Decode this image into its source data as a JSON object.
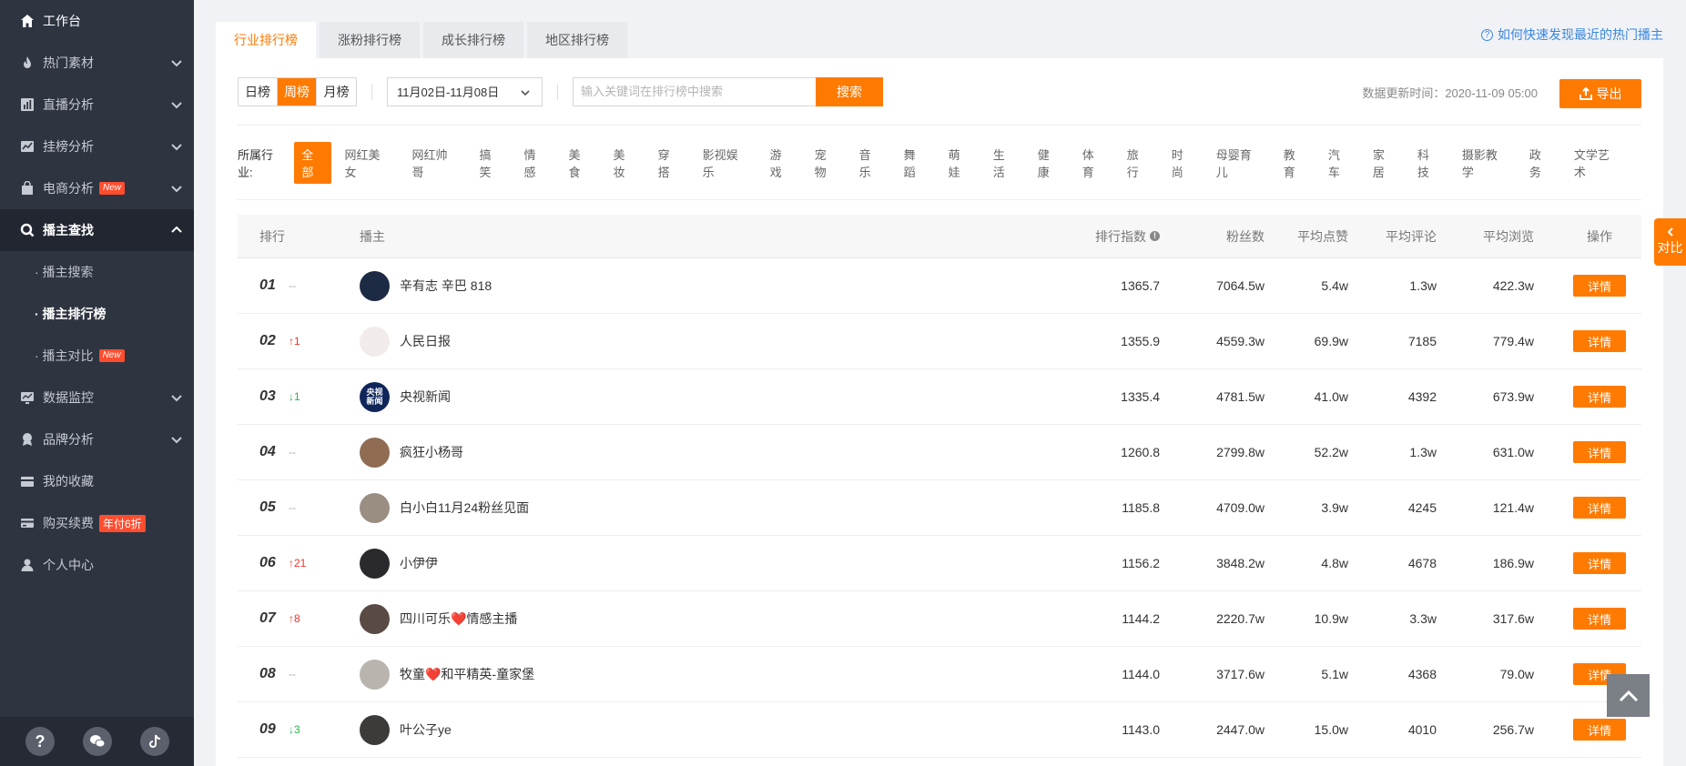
{
  "sidebar": {
    "items": [
      {
        "label": "工作台",
        "icon": "home-icon",
        "has_arrow": false
      },
      {
        "label": "热门素材",
        "icon": "fire-icon",
        "has_arrow": true
      },
      {
        "label": "直播分析",
        "icon": "bar-chart-icon",
        "has_arrow": true
      },
      {
        "label": "挂榜分析",
        "icon": "trend-icon",
        "has_arrow": true
      },
      {
        "label": "电商分析",
        "icon": "shopping-bag-icon",
        "has_arrow": true,
        "badge": "New"
      },
      {
        "label": "播主查找",
        "icon": "search-icon",
        "has_arrow": true,
        "expanded": true
      }
    ],
    "sub_items": [
      {
        "label": "· 播主搜索"
      },
      {
        "label": "· 播主排行榜"
      },
      {
        "label": "· 播主对比",
        "badge": "New"
      }
    ],
    "items_after": [
      {
        "label": "数据监控",
        "icon": "monitor-icon",
        "has_arrow": true
      },
      {
        "label": "品牌分析",
        "icon": "brand-icon",
        "has_arrow": true
      },
      {
        "label": "我的收藏",
        "icon": "wallet-icon"
      },
      {
        "label": "购买续费",
        "icon": "card-icon",
        "badge": "年付6折"
      },
      {
        "label": "个人中心",
        "icon": "user-icon"
      }
    ]
  },
  "tabs": [
    "行业排行榜",
    "涨粉排行榜",
    "成长排行榜",
    "地区排行榜"
  ],
  "help_link": "如何快速发现最近的热门播主",
  "toolbar": {
    "period_buttons": [
      "日榜",
      "周榜",
      "月榜"
    ],
    "date_range": "11月02日-11月08日",
    "search_placeholder": "输入关键词在排行榜中搜索",
    "search_button": "搜索",
    "update_time": "数据更新时间：2020-11-09 05:00",
    "export_button": "导出"
  },
  "industry": {
    "label": "所属行业:",
    "tags": [
      "全部",
      "网红美女",
      "网红帅哥",
      "搞笑",
      "情感",
      "美食",
      "美妆",
      "穿搭",
      "影视娱乐",
      "游戏",
      "宠物",
      "音乐",
      "舞蹈",
      "萌娃",
      "生活",
      "健康",
      "体育",
      "旅行",
      "时尚",
      "母婴育儿",
      "教育",
      "汽车",
      "家居",
      "科技",
      "摄影教学",
      "政务",
      "文学艺术"
    ]
  },
  "table": {
    "headers": {
      "rank": "排行",
      "anchor": "播主",
      "index": "排行指数",
      "fans": "粉丝数",
      "likes": "平均点赞",
      "comments": "平均评论",
      "views": "平均浏览",
      "action": "操作"
    },
    "rows": [
      {
        "rank": "01",
        "change": "--",
        "dir": "same",
        "name": "辛有志 辛巴 818",
        "index": "1365.7",
        "fans": "7064.5w",
        "likes": "5.4w",
        "comments": "1.3w",
        "views": "422.3w",
        "avatar_color": "#1d2a44",
        "avatar_text": ""
      },
      {
        "rank": "02",
        "change": "↑1",
        "dir": "up",
        "name": "人民日报",
        "index": "1355.9",
        "fans": "4559.3w",
        "likes": "69.9w",
        "comments": "7185",
        "views": "779.4w",
        "avatar_color": "#f1ecea",
        "avatar_text": ""
      },
      {
        "rank": "03",
        "change": "↓1",
        "dir": "down",
        "name": "央视新闻",
        "index": "1335.4",
        "fans": "4781.5w",
        "likes": "41.0w",
        "comments": "4392",
        "views": "673.9w",
        "avatar_color": "#10265a",
        "avatar_text": "央视新闻"
      },
      {
        "rank": "04",
        "change": "--",
        "dir": "same",
        "name": "疯狂小杨哥",
        "index": "1260.8",
        "fans": "2799.8w",
        "likes": "52.2w",
        "comments": "1.3w",
        "views": "631.0w",
        "avatar_color": "#8f6c52",
        "avatar_text": ""
      },
      {
        "rank": "05",
        "change": "--",
        "dir": "same",
        "name": "白小白11月24粉丝见面",
        "index": "1185.8",
        "fans": "4709.0w",
        "likes": "3.9w",
        "comments": "4245",
        "views": "121.4w",
        "avatar_color": "#9a8d82",
        "avatar_text": ""
      },
      {
        "rank": "06",
        "change": "↑21",
        "dir": "up",
        "name": "小伊伊",
        "index": "1156.2",
        "fans": "3848.2w",
        "likes": "4.8w",
        "comments": "4678",
        "views": "186.9w",
        "avatar_color": "#2a2a2e",
        "avatar_text": ""
      },
      {
        "rank": "07",
        "change": "↑8",
        "dir": "up",
        "name": "四川可乐❤️情感主播",
        "index": "1144.2",
        "fans": "2220.7w",
        "likes": "10.9w",
        "comments": "3.3w",
        "views": "317.6w",
        "avatar_color": "#5a4a44",
        "avatar_text": ""
      },
      {
        "rank": "08",
        "change": "--",
        "dir": "same",
        "name": "牧童❤️和平精英-童家堡",
        "index": "1144.0",
        "fans": "3717.6w",
        "likes": "5.1w",
        "comments": "4368",
        "views": "79.0w",
        "avatar_color": "#b9b4ae",
        "avatar_text": ""
      },
      {
        "rank": "09",
        "change": "↓3",
        "dir": "down",
        "name": "叶公子ye",
        "index": "1143.0",
        "fans": "2447.0w",
        "likes": "15.0w",
        "comments": "4010",
        "views": "256.7w",
        "avatar_color": "#3d3b3a",
        "avatar_text": ""
      }
    ],
    "detail_label": "详情"
  },
  "compare_tab": "对比",
  "colors": {
    "accent": "#ff7a00",
    "sidebar_bg": "#2f3441",
    "up": "#f0322a",
    "down": "#2bb24c",
    "link": "#3a86e3"
  }
}
